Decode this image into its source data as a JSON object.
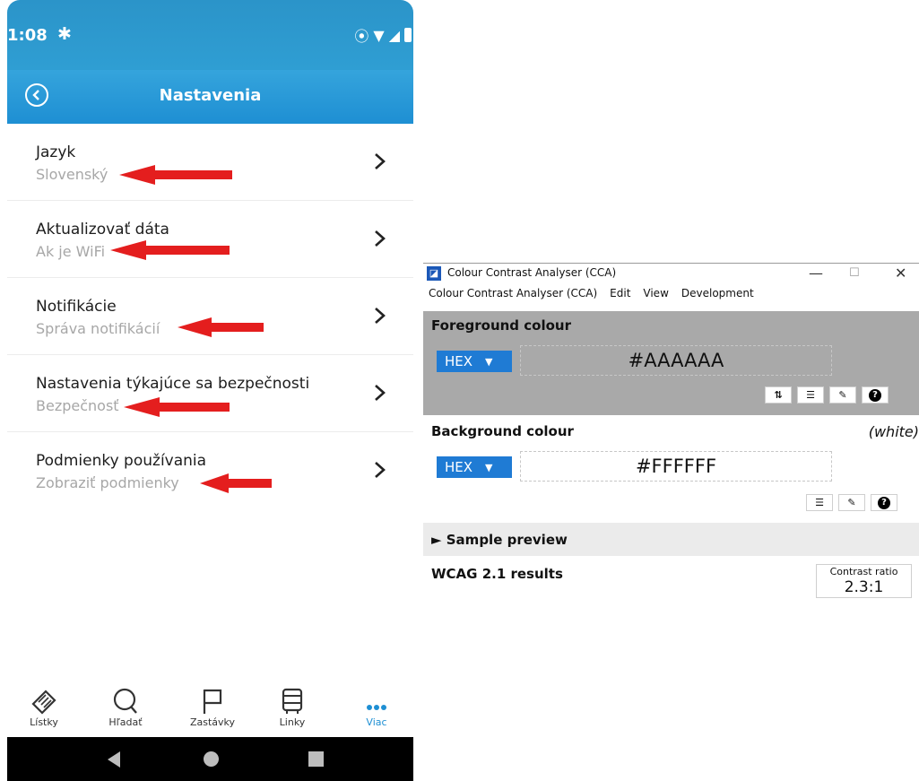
{
  "phone": {
    "status_time": "1:08",
    "header_title": "Nastavenia",
    "items": [
      {
        "title": "Jazyk",
        "subtitle": "Slovenský"
      },
      {
        "title": "Aktualizovať dáta",
        "subtitle": "Ak je WiFi"
      },
      {
        "title": "Notifikácie",
        "subtitle": "Správa notifikácií"
      },
      {
        "title": "Nastavenia týkajúce sa bezpečnosti",
        "subtitle": "Bezpečnosť"
      },
      {
        "title": "Podmienky používania",
        "subtitle": "Zobraziť podmienky"
      }
    ],
    "nav": [
      "Lístky",
      "Hľadať",
      "Zastávky",
      "Linky",
      "Viac"
    ],
    "colors": {
      "header": "#2b94c9",
      "annotation_arrow": "#e41e1e",
      "active_nav": "#1e8fd3"
    }
  },
  "cca": {
    "window_title": "Colour Contrast Analyser (CCA)",
    "menu": [
      "Colour Contrast Analyser (CCA)",
      "Edit",
      "View",
      "Development"
    ],
    "foreground": {
      "label": "Foreground colour",
      "format": "HEX",
      "value": "#AAAAAA"
    },
    "background": {
      "label": "Background colour",
      "note": "(white)",
      "format": "HEX",
      "value": "#FFFFFF"
    },
    "sample_preview": "► Sample preview",
    "results_label": "WCAG 2.1 results",
    "contrast_label": "Contrast ratio",
    "contrast_value": "2.3:1"
  }
}
